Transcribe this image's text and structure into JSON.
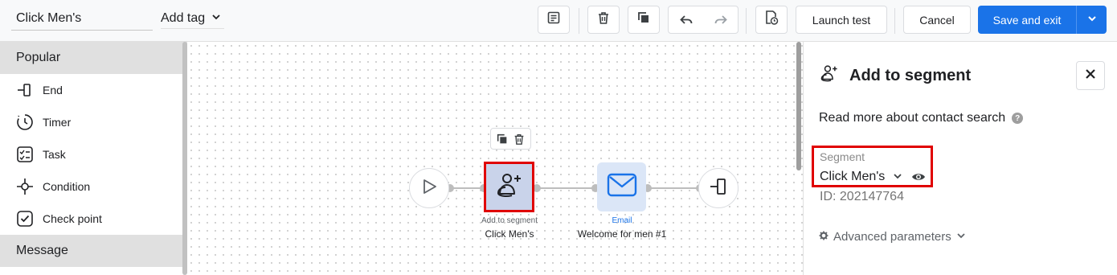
{
  "toolbar": {
    "campaign_name": "Click Men's",
    "add_tag_label": "Add tag",
    "launch_test_label": "Launch test",
    "cancel_label": "Cancel",
    "save_label": "Save and exit",
    "icons": [
      "notes-icon",
      "trash-icon",
      "copy-icon",
      "undo-icon",
      "redo-icon",
      "document-history-icon",
      "chevron-down-icon"
    ]
  },
  "palette": {
    "groups": [
      {
        "title": "Popular",
        "items": [
          {
            "label": "End",
            "icon": "end-icon"
          },
          {
            "label": "Timer",
            "icon": "timer-icon"
          },
          {
            "label": "Task",
            "icon": "task-icon"
          },
          {
            "label": "Condition",
            "icon": "condition-icon"
          },
          {
            "label": "Check point",
            "icon": "check-point-icon"
          }
        ]
      },
      {
        "title": "Message",
        "items": []
      }
    ]
  },
  "canvas": {
    "nodes": [
      {
        "kind": "start",
        "icon": "play-icon"
      },
      {
        "kind": "segment",
        "type_label": "Add to segment",
        "name": "Click Men's",
        "icon": "segment-add-icon",
        "selected": true
      },
      {
        "kind": "email",
        "type_label": "Email",
        "name": "Welcome for men #1",
        "icon": "mail-icon"
      },
      {
        "kind": "end",
        "icon": "end-icon"
      }
    ],
    "node_actions": [
      "copy-icon",
      "trash-icon"
    ]
  },
  "panel": {
    "title": "Add to segment",
    "read_more_label": "Read more about contact search",
    "segment_label": "Segment",
    "segment_value": "Click Men's",
    "segment_id": "ID: 202147764",
    "advanced_label": "Advanced parameters"
  },
  "colors": {
    "accent": "#1a73e8",
    "highlight": "#e00000",
    "segment_node_bg": "#c9d3ea",
    "email_node_bg": "#dbe6f7",
    "toolbar_bg": "#f8f9fa"
  }
}
